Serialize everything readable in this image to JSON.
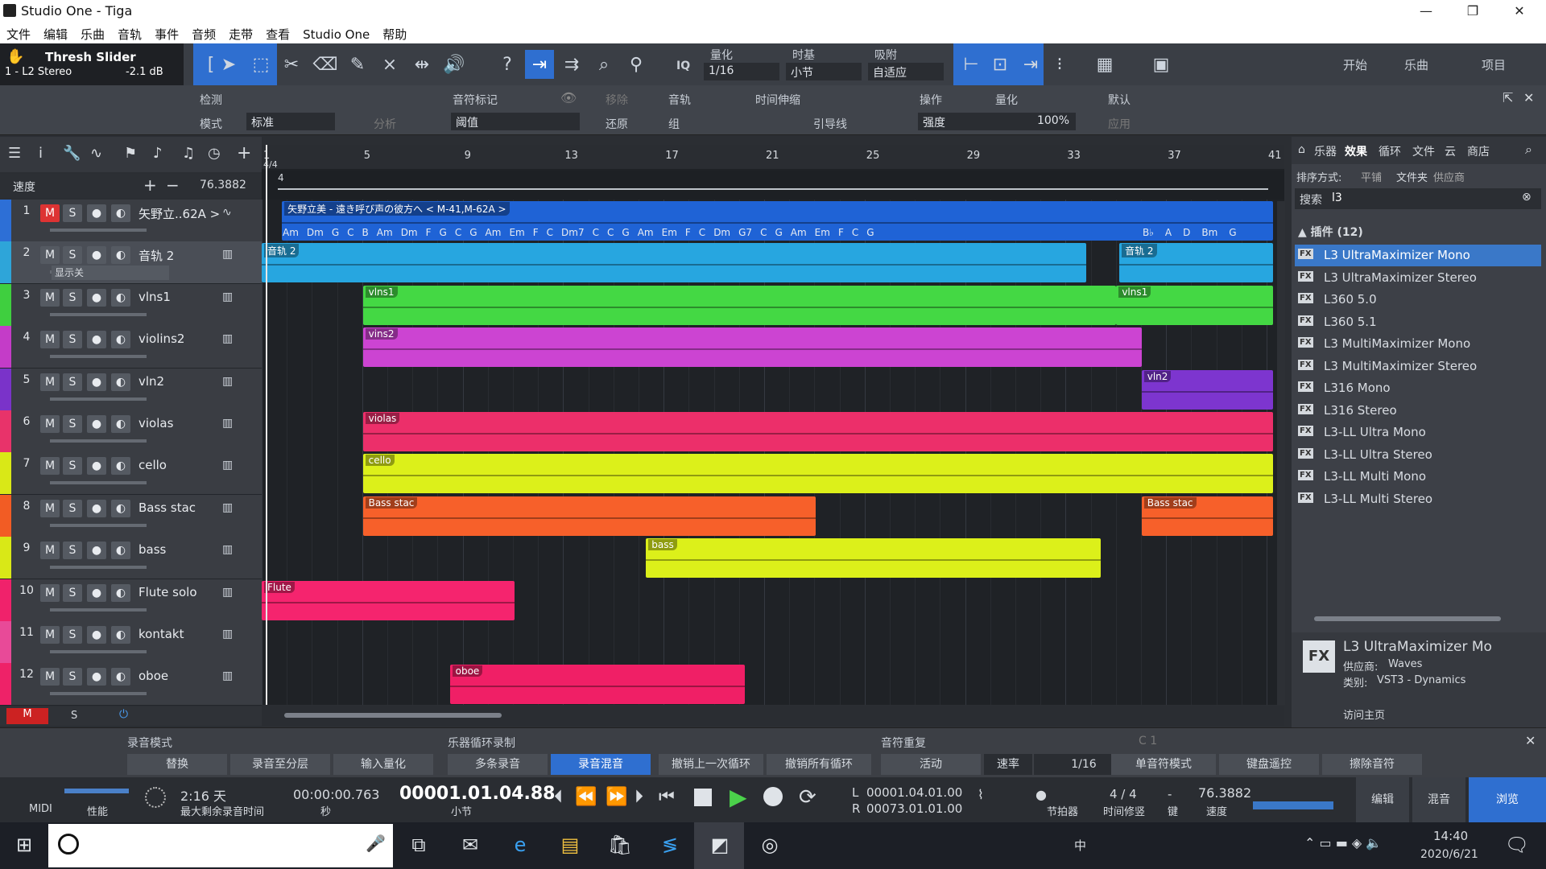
{
  "window": {
    "title": "Studio One - Tiga",
    "min": "—",
    "max": "❐",
    "close": "✕"
  },
  "menu": [
    "文件",
    "编辑",
    "乐曲",
    "音轨",
    "事件",
    "音频",
    "走带",
    "查看",
    "Studio One",
    "帮助"
  ],
  "toolbar": {
    "preset_name": "Thresh Slider",
    "preset_track": "1 - L2 Stereo",
    "preset_db": "-2.1 dB",
    "quantize_label": "量化",
    "quantize_value": "1/16",
    "timebase_label": "时基",
    "timebase_value": "小节",
    "snap_label": "吸附",
    "snap_value": "自适应",
    "iq": "IQ",
    "start": "开始",
    "song": "乐曲",
    "project": "项目"
  },
  "inspector": {
    "detect": "检测",
    "mode": "模式",
    "mode_value": "标准",
    "analyze": "分析",
    "transient": "音符标记",
    "remove": "移除",
    "threshold": "阈值",
    "restore": "还原",
    "track": "音轨",
    "timestretch": "时间伸缩",
    "group": "组",
    "guide": "引导线",
    "action": "操作",
    "quant": "量化",
    "default": "默认",
    "strength": "强度",
    "strength_value": "100%",
    "apply": "应用"
  },
  "ruler": {
    "marks": [
      "1",
      "5",
      "9",
      "13",
      "17",
      "21",
      "25",
      "29",
      "33",
      "37",
      "41"
    ],
    "sig": "4/4",
    "tempo_label": "速度",
    "tempo_value": "76.3882",
    "tempo_marker": "4"
  },
  "tracks": [
    {
      "n": "1",
      "name": "矢野立..62A >",
      "color": "#2d6fd6",
      "type": "audio"
    },
    {
      "n": "2",
      "name": "音轨 2",
      "color": "#2ea5d9",
      "type": "inst",
      "sub": "显示关"
    },
    {
      "n": "3",
      "name": "vlns1",
      "color": "#3fcf3f",
      "type": "inst"
    },
    {
      "n": "4",
      "name": "violins2",
      "color": "#c43cc8",
      "type": "inst"
    },
    {
      "n": "5",
      "name": "vln2",
      "color": "#7a33c9",
      "type": "inst"
    },
    {
      "n": "6",
      "name": "violas",
      "color": "#e8336a",
      "type": "inst"
    },
    {
      "n": "7",
      "name": "cello",
      "color": "#d9e817",
      "type": "inst"
    },
    {
      "n": "8",
      "name": "Bass stac",
      "color": "#f25c24",
      "type": "inst"
    },
    {
      "n": "9",
      "name": "bass",
      "color": "#d9e817",
      "type": "inst"
    },
    {
      "n": "10",
      "name": "Flute solo",
      "color": "#f0226b",
      "type": "inst"
    },
    {
      "n": "11",
      "name": "kontakt",
      "color": "#e84a98",
      "type": "inst"
    },
    {
      "n": "12",
      "name": "oboe",
      "color": "#ee2268",
      "type": "inst"
    }
  ],
  "track_buttons": {
    "m": "M",
    "s": "S",
    "rec": "●",
    "mon": "◐"
  },
  "clips": [
    {
      "row": 0,
      "start": 0.02,
      "end": 1.0,
      "label": "矢野立美 - 遠き呼び声の彼方へ < M-41,M-62A >",
      "color": "#1f63d6"
    },
    {
      "row": 1,
      "start": 0.0,
      "end": 0.815,
      "label": "音轨 2",
      "color": "#27a6e0"
    },
    {
      "row": 1,
      "start": 0.848,
      "end": 1.0,
      "label": "音轨 2",
      "color": "#27a6e0"
    },
    {
      "row": 2,
      "start": 0.1,
      "end": 0.845,
      "label": "vlns1",
      "color": "#44d844"
    },
    {
      "row": 2,
      "start": 0.845,
      "end": 1.0,
      "label": "vlns1",
      "color": "#44d844"
    },
    {
      "row": 3,
      "start": 0.1,
      "end": 0.87,
      "label": "vins2",
      "color": "#cc44d2"
    },
    {
      "row": 4,
      "start": 0.87,
      "end": 1.0,
      "label": "vln2",
      "color": "#7d35cf"
    },
    {
      "row": 5,
      "start": 0.1,
      "end": 1.0,
      "label": "violas",
      "color": "#ec2f6a"
    },
    {
      "row": 6,
      "start": 0.1,
      "end": 1.0,
      "label": "cello",
      "color": "#dcf01a"
    },
    {
      "row": 7,
      "start": 0.1,
      "end": 0.548,
      "label": "Bass stac",
      "color": "#f7602a"
    },
    {
      "row": 7,
      "start": 0.87,
      "end": 1.0,
      "label": "Bass stac",
      "color": "#f7602a"
    },
    {
      "row": 8,
      "start": 0.38,
      "end": 0.83,
      "label": "bass",
      "color": "#dcf01a"
    },
    {
      "row": 9,
      "start": 0.0,
      "end": 0.25,
      "label": "Flute",
      "color": "#f5246e"
    },
    {
      "row": 11,
      "start": 0.186,
      "end": 0.478,
      "label": "oboe",
      "color": "#f01f66"
    }
  ],
  "chords": [
    "Am",
    "Dm",
    "G",
    "C",
    "B",
    "Am",
    "Dm",
    "F",
    "G",
    "C",
    "G",
    "Am",
    "Em",
    "F",
    "C",
    "Dm7",
    "C",
    "C",
    "G",
    "Am",
    "Em",
    "F",
    "C",
    "Dm",
    "G7",
    "C",
    "G",
    "Am",
    "Em",
    "F",
    "C",
    "G"
  ],
  "chords2": [
    "B♭",
    "A",
    "D",
    "Bm",
    "G"
  ],
  "browser": {
    "tabs": [
      "乐器",
      "效果",
      "循环",
      "文件",
      "云",
      "商店"
    ],
    "sort_label": "排序方式:",
    "sort_flat": "平铺",
    "sort_folder": "文件夹",
    "sort_vendor": "供应商",
    "search_label": "搜索",
    "search_value": "l3",
    "group_label": "插件 (12)",
    "plugins": [
      "L3 UltraMaximizer Mono",
      "L3 UltraMaximizer Stereo",
      "L360 5.0",
      "L360 5.1",
      "L3 MultiMaximizer Mono",
      "L3 MultiMaximizer Stereo",
      "L316 Mono",
      "L316 Stereo",
      "L3-LL Ultra Mono",
      "L3-LL Ultra Stereo",
      "L3-LL Multi Mono",
      "L3-LL Multi Stereo"
    ],
    "info_title": "L3 UltraMaximizer Mo",
    "info_vendor_label": "供应商:",
    "info_vendor": "Waves",
    "info_type_label": "类别:",
    "info_type": "VST3 - Dynamics",
    "homepage": "访问主页",
    "fx": "FX"
  },
  "record": {
    "mode_label": "录音模式",
    "loop_label": "乐器循环录制",
    "repeat_label": "音符重复",
    "c1": "C 1",
    "buttons1": [
      "替换",
      "录音至分层",
      "输入量化"
    ],
    "buttons2": [
      "多条录音",
      "录音混音"
    ],
    "buttons3": [
      "撤销上一次循环",
      "撤销所有循环"
    ],
    "buttons4": [
      "活动",
      "速率",
      "1/16",
      "单音符模式",
      "键盘遥控",
      "擦除音符"
    ]
  },
  "transport": {
    "midi": "MIDI",
    "perf": "性能",
    "rectime": "2:16 天",
    "rectime_label": "最大剩余录音时间",
    "time_sec": "00:00:00.763",
    "sec_label": "秒",
    "position": "00001.01.04.88",
    "bar_label": "小节",
    "loopL": "00001.04.01.00",
    "loopR": "00073.01.01.00",
    "L": "L",
    "R": "R",
    "metronome": "节拍器",
    "sig": "4 / 4",
    "sig_label": "时间修竖",
    "key": "-",
    "key_label": "键",
    "tempo": "76.3882",
    "tempo_label": "速度",
    "edit": "编辑",
    "mix": "混音",
    "browse": "浏览"
  },
  "bottom": {
    "m": "M",
    "s": "S"
  },
  "taskbar": {
    "time": "14:40",
    "date": "2020/6/21",
    "ime": "中"
  }
}
